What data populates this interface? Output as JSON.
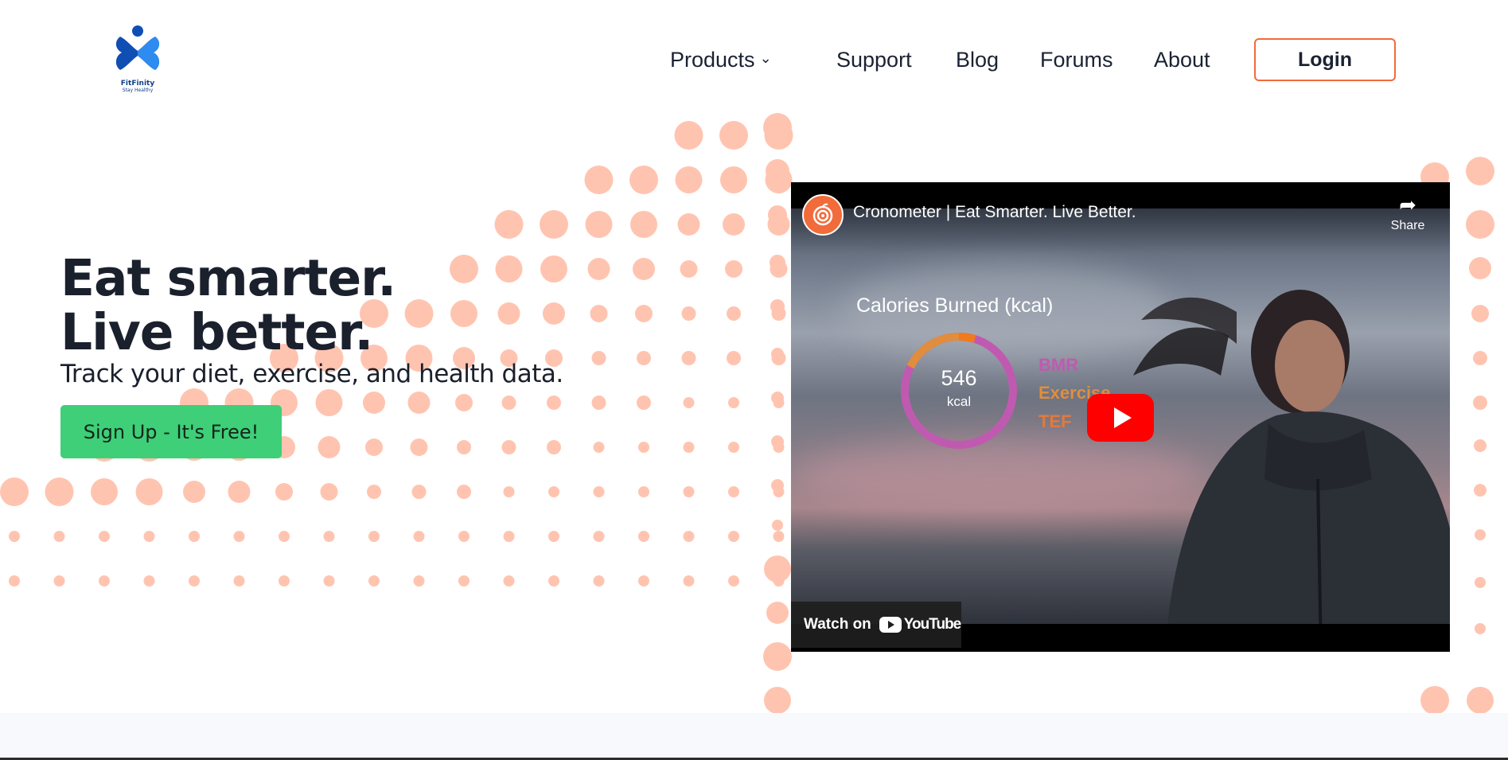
{
  "brand": {
    "name": "FitFinity",
    "tagline": "Stay Healthy",
    "colors": {
      "logo_dark": "#0f4fb4",
      "logo_light": "#2e8bef"
    }
  },
  "nav": {
    "products": "Products",
    "support": "Support",
    "blog": "Blog",
    "forums": "Forums",
    "about": "About",
    "login": "Login"
  },
  "hero": {
    "title_line1": "Eat smarter.",
    "title_line2": "Live better.",
    "subtitle": "Track your diet, exercise, and health data.",
    "cta": "Sign Up - It's Free!"
  },
  "video": {
    "title": "Cronometer | Eat Smarter. Live Better.",
    "share_label": "Share",
    "overlay_title": "Calories Burned (kcal)",
    "calories_value": "546",
    "calories_unit": "kcal",
    "legend": [
      "BMR",
      "Exercise",
      "TEF"
    ],
    "watch_on": "Watch on",
    "youtube": "YouTube"
  },
  "colors": {
    "accent_orange": "#f26b3a",
    "cta_green": "#3ecf78",
    "dot_color": "#ffc4b0",
    "youtube_red": "#ff0000"
  }
}
